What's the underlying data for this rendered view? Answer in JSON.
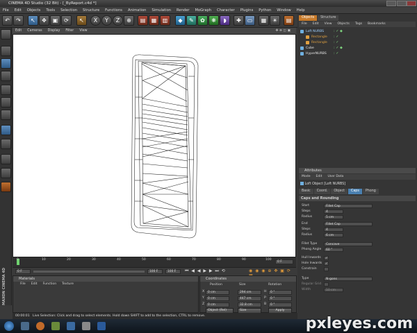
{
  "window": {
    "title": "CINEMA 4D Studio (32 Bit) - [_ByReport.c4d *]"
  },
  "menu": [
    "File",
    "Edit",
    "Objects",
    "Tools",
    "Selection",
    "Structure",
    "Functions",
    "Animation",
    "Simulation",
    "Render",
    "MoGraph",
    "Character",
    "Plugins",
    "Python",
    "Window",
    "Help"
  ],
  "viewport_menu": [
    "Edit",
    "Cameras",
    "Display",
    "Filter",
    "View"
  ],
  "timeline": {
    "ticks": [
      "0",
      "10",
      "20",
      "30",
      "40",
      "50",
      "60",
      "70",
      "80",
      "90",
      "100"
    ],
    "end_field": "0 F"
  },
  "transport": {
    "start": "0 F",
    "end_a": "100 F",
    "end_b": "100 F"
  },
  "object_manager": {
    "tabs": [
      "Objects",
      "Structure"
    ],
    "menu": [
      "File",
      "Edit",
      "View",
      "Objects",
      "Tags",
      "Bookmarks"
    ],
    "items": [
      {
        "name": "Loft NURBS",
        "color": "#6fb0e0"
      },
      {
        "name": "Rectangle",
        "color": "#e0a040"
      },
      {
        "name": "Rectangle",
        "color": "#e0a040"
      },
      {
        "name": "Cube",
        "color": "#6fb0e0"
      },
      {
        "name": "HyperNURBS",
        "color": "#6fb0e0"
      }
    ]
  },
  "attributes": {
    "header": "Attributes",
    "menu": [
      "Mode",
      "Edit",
      "User Data"
    ],
    "object_label": "Loft Object [Loft NURBS]",
    "tabs": [
      "Basic",
      "Coord.",
      "Object",
      "Caps",
      "Phong"
    ],
    "section": "Caps and Rounding",
    "rows": [
      {
        "label": "Start",
        "value": "Fillet Cap"
      },
      {
        "label": "Steps",
        "value": "4"
      },
      {
        "label": "Radius",
        "value": "5 cm"
      },
      {
        "label": "End",
        "value": "Fillet Cap"
      },
      {
        "label": "Steps",
        "value": "4"
      },
      {
        "label": "Radius",
        "value": "6 cm"
      },
      {
        "label": "Fillet Type",
        "value": "Concave"
      },
      {
        "label": "Phong Angle",
        "value": "60 °"
      },
      {
        "label": "Hull Inwards",
        "value": "✓"
      },
      {
        "label": "Hole Inwards",
        "value": "✓"
      },
      {
        "label": "Constrain",
        "value": ""
      },
      {
        "label": "Type",
        "value": "N-gons"
      },
      {
        "label": "Regular Grid",
        "value": ""
      },
      {
        "label": "Width",
        "value": "10 cm"
      }
    ]
  },
  "materials": {
    "header": "Materials",
    "menu": [
      "File",
      "Edit",
      "Function",
      "Texture"
    ]
  },
  "coordinates": {
    "header": "Coordinates",
    "cols": [
      "Position",
      "Size",
      "Rotation"
    ],
    "rows": [
      {
        "axis": "X",
        "pos": "0 cm",
        "size": "294 cm",
        "rot_label": "H",
        "rot": "0 °"
      },
      {
        "axis": "Y",
        "pos": "0 cm",
        "size": "447 cm",
        "rot_label": "P",
        "rot": "0 °"
      },
      {
        "axis": "Z",
        "pos": "0 cm",
        "size": "32.8 cm",
        "rot_label": "B",
        "rot": "0 °"
      }
    ],
    "mode_a": "Object (Rel)",
    "mode_b": "Size",
    "apply": "Apply"
  },
  "status": {
    "time": "00:00:01",
    "text": "Live Selection: Click and drag to select elements. Hold down SHIFT to add to the selection, CTRL to remove."
  },
  "side_label": "MAXON CINEMA 4D",
  "watermark": "pxleyes.com"
}
